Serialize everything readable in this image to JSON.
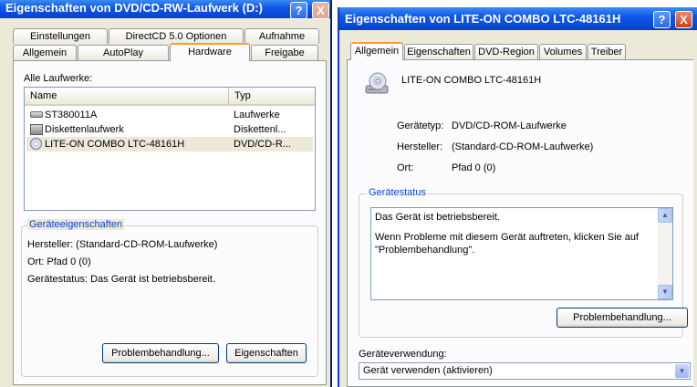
{
  "left_window": {
    "title": "Eigenschaften von DVD/CD-RW-Laufwerk (D:)",
    "help_label": "?",
    "close_label": "X",
    "tabs_row1": [
      "Einstellungen",
      "DirectCD 5.0 Optionen",
      "Aufnahme"
    ],
    "tabs_row2": [
      "Allgemein",
      "AutoPlay",
      "Hardware",
      "Freigabe"
    ],
    "active_tab": "Hardware",
    "drives_label": "Alle Laufwerke:",
    "columns": [
      "Name",
      "Typ"
    ],
    "drives": [
      {
        "name": "ST380011A",
        "type": "Laufwerke",
        "icon": "hard-disk-icon"
      },
      {
        "name": "Diskettenlaufwerk",
        "type": "Diskettenl...",
        "icon": "floppy-drive-icon"
      },
      {
        "name": "LITE-ON COMBO LTC-48161H",
        "type": "DVD/CD-R...",
        "icon": "cd-drive-icon"
      }
    ],
    "properties_group": "Geräteeigenschaften",
    "manufacturer": "Hersteller: (Standard-CD-ROM-Laufwerke)",
    "location": "Ort: Pfad 0 (0)",
    "status": "Gerätestatus: Das Gerät ist betriebsbereit.",
    "troubleshoot_button": "Problembehandlung...",
    "properties_button": "Eigenschaften"
  },
  "right_window": {
    "title": "Eigenschaften von LITE-ON COMBO LTC-48161H",
    "help_label": "?",
    "close_label": "X",
    "tabs": [
      "Allgemein",
      "Eigenschaften",
      "DVD-Region",
      "Volumes",
      "Treiber"
    ],
    "active_tab": "Allgemein",
    "device_name": "LITE-ON COMBO LTC-48161H",
    "device_type_label": "Gerätetyp:",
    "device_type_value": "DVD/CD-ROM-Laufwerke",
    "manufacturer_label": "Hersteller:",
    "manufacturer_value": "(Standard-CD-ROM-Laufwerke)",
    "location_label": "Ort:",
    "location_value": "Pfad 0 (0)",
    "status_group": "Gerätestatus",
    "status_line1": "Das Gerät ist betriebsbereit.",
    "status_line2": "Wenn Probleme mit diesem Gerät auftreten, klicken Sie auf",
    "status_line3": "\"Problembehandlung\".",
    "troubleshoot_button": "Problembehandlung...",
    "usage_label": "Geräteverwendung:",
    "usage_value": "Gerät verwenden (aktivieren)"
  }
}
